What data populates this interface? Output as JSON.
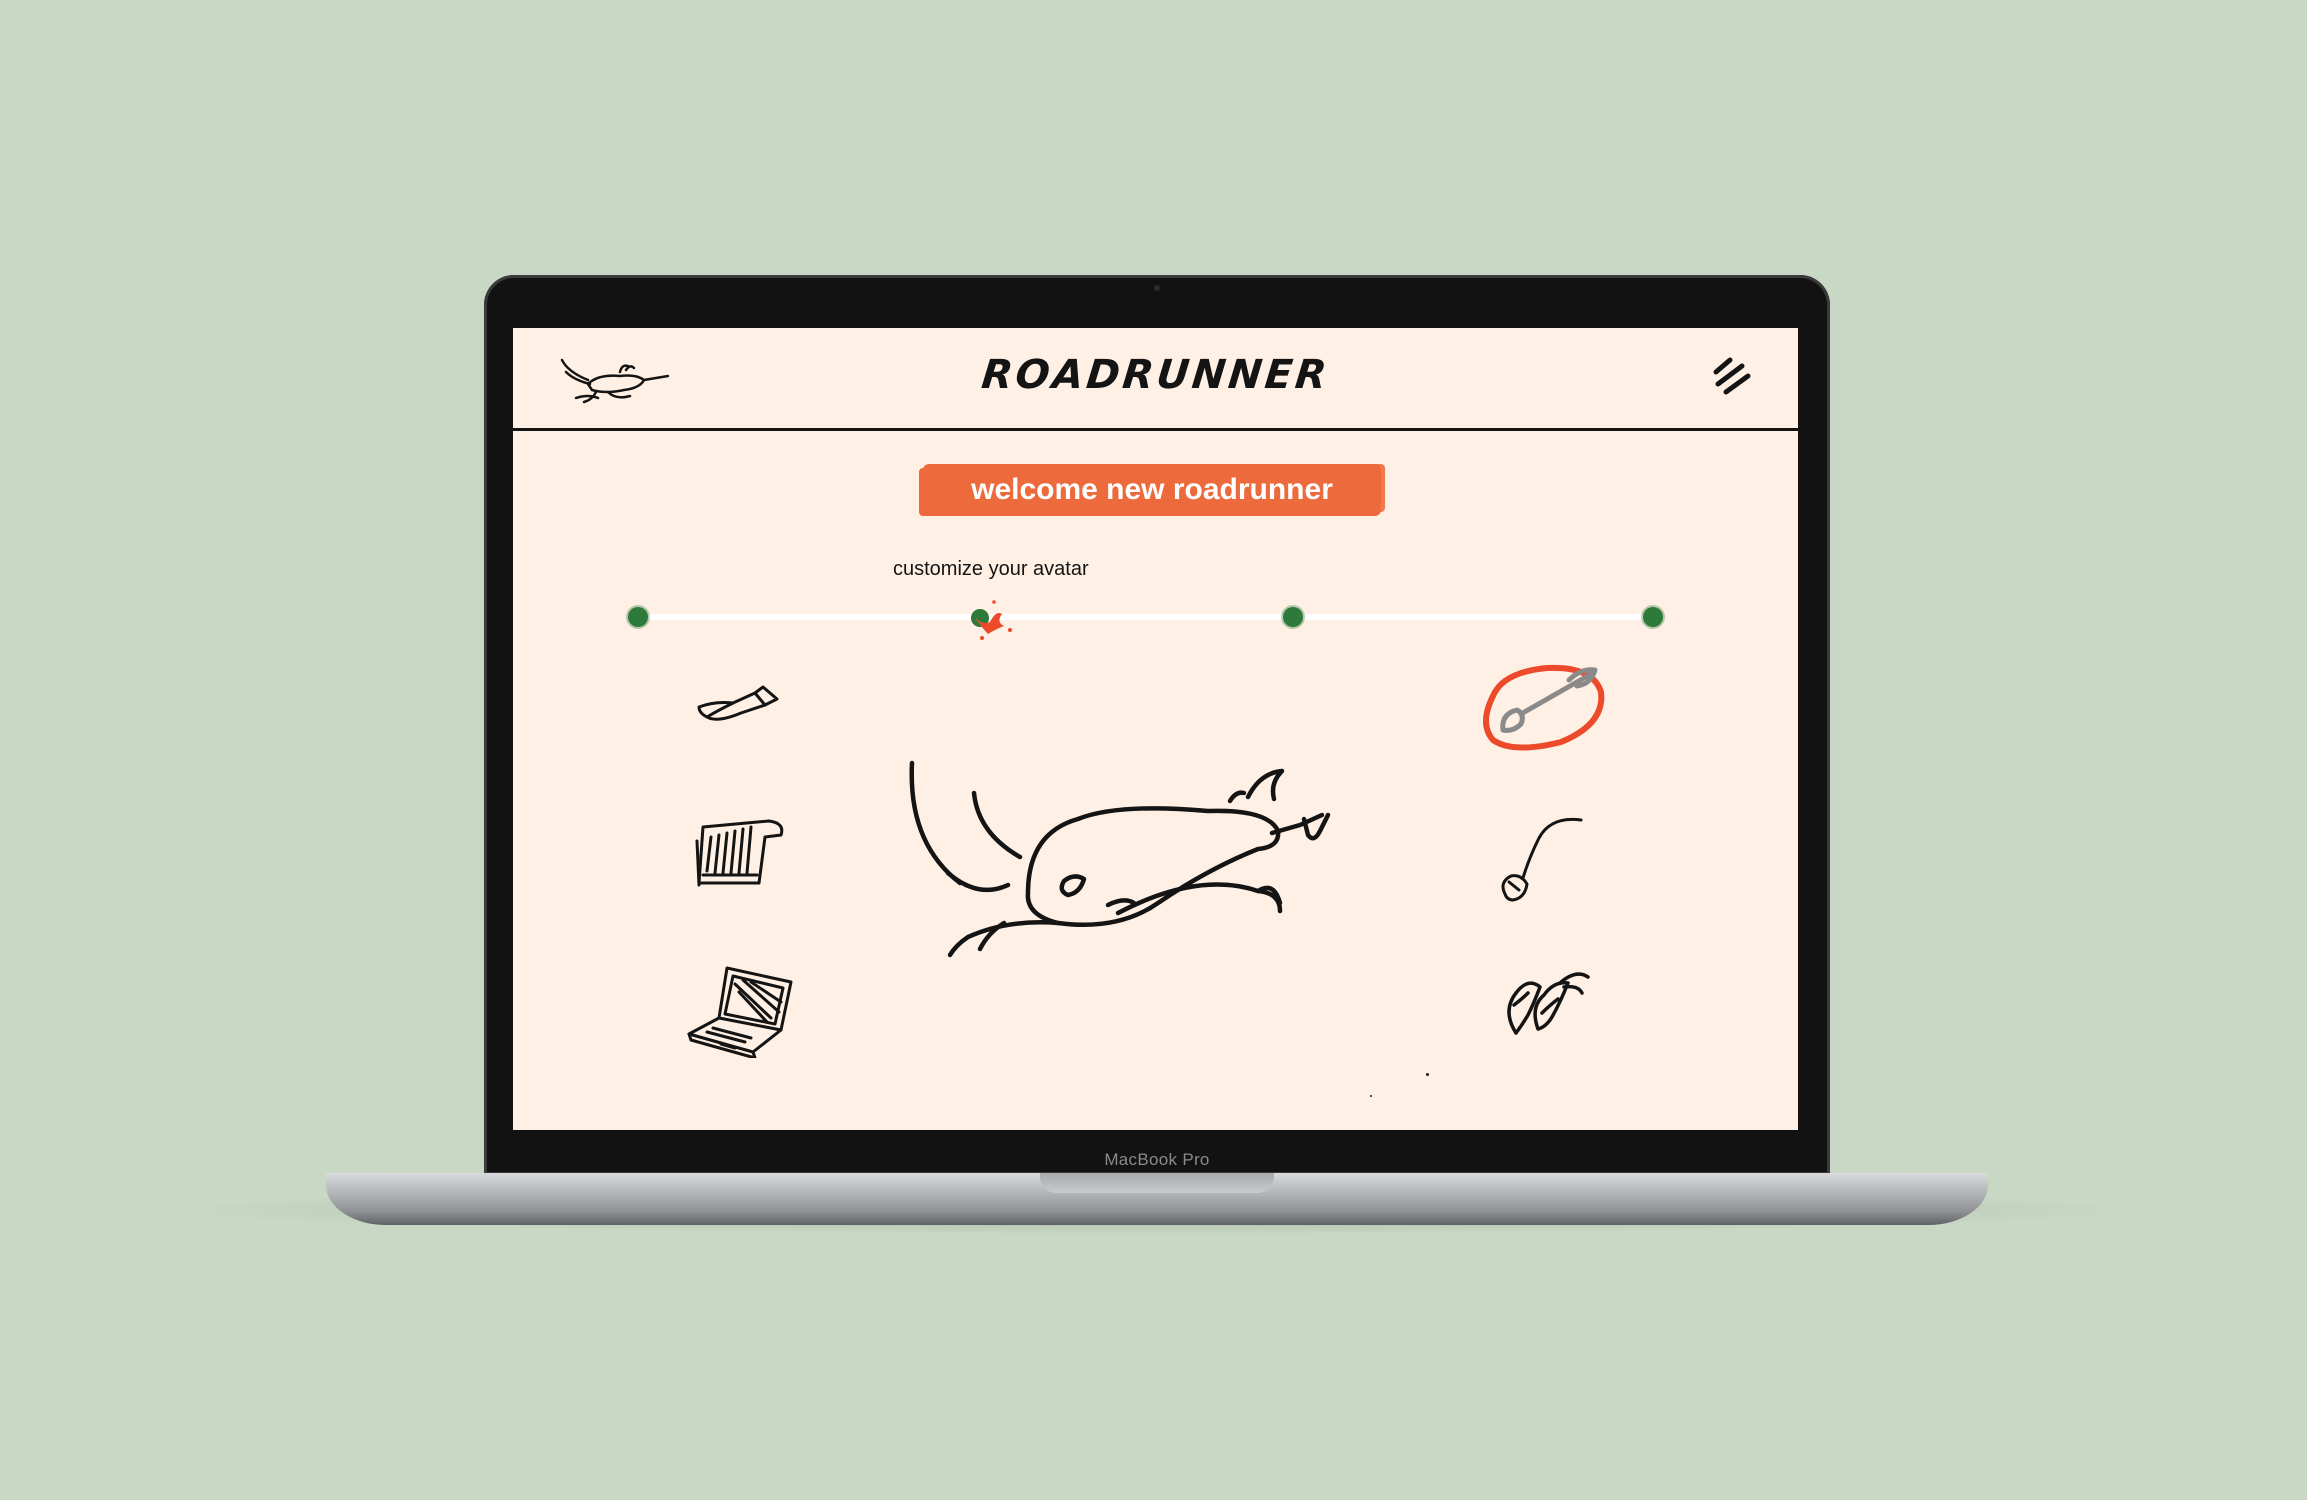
{
  "app": {
    "brand": "ROADRUNNER",
    "device_label": "MacBook Pro"
  },
  "onboarding": {
    "banner": "welcome new roadrunner",
    "step_label": "customize your avatar",
    "steps_total": 4,
    "current_step": 2
  },
  "accessories": {
    "left": [
      {
        "name": "tie",
        "icon": "tie-icon"
      },
      {
        "name": "notebook",
        "icon": "notebook-icon"
      },
      {
        "name": "laptop",
        "icon": "laptop-icon"
      }
    ],
    "right": [
      {
        "name": "paintbrush",
        "icon": "paintbrush-icon",
        "selected": true
      },
      {
        "name": "mouse",
        "icon": "mouse-icon"
      },
      {
        "name": "leaves",
        "icon": "leaf-icon"
      }
    ]
  },
  "colors": {
    "background": "#c8d8c4",
    "screen": "#fff0e5",
    "accent": "#ec6a3b",
    "step_dot": "#2d7a3b",
    "ink": "#141414"
  }
}
